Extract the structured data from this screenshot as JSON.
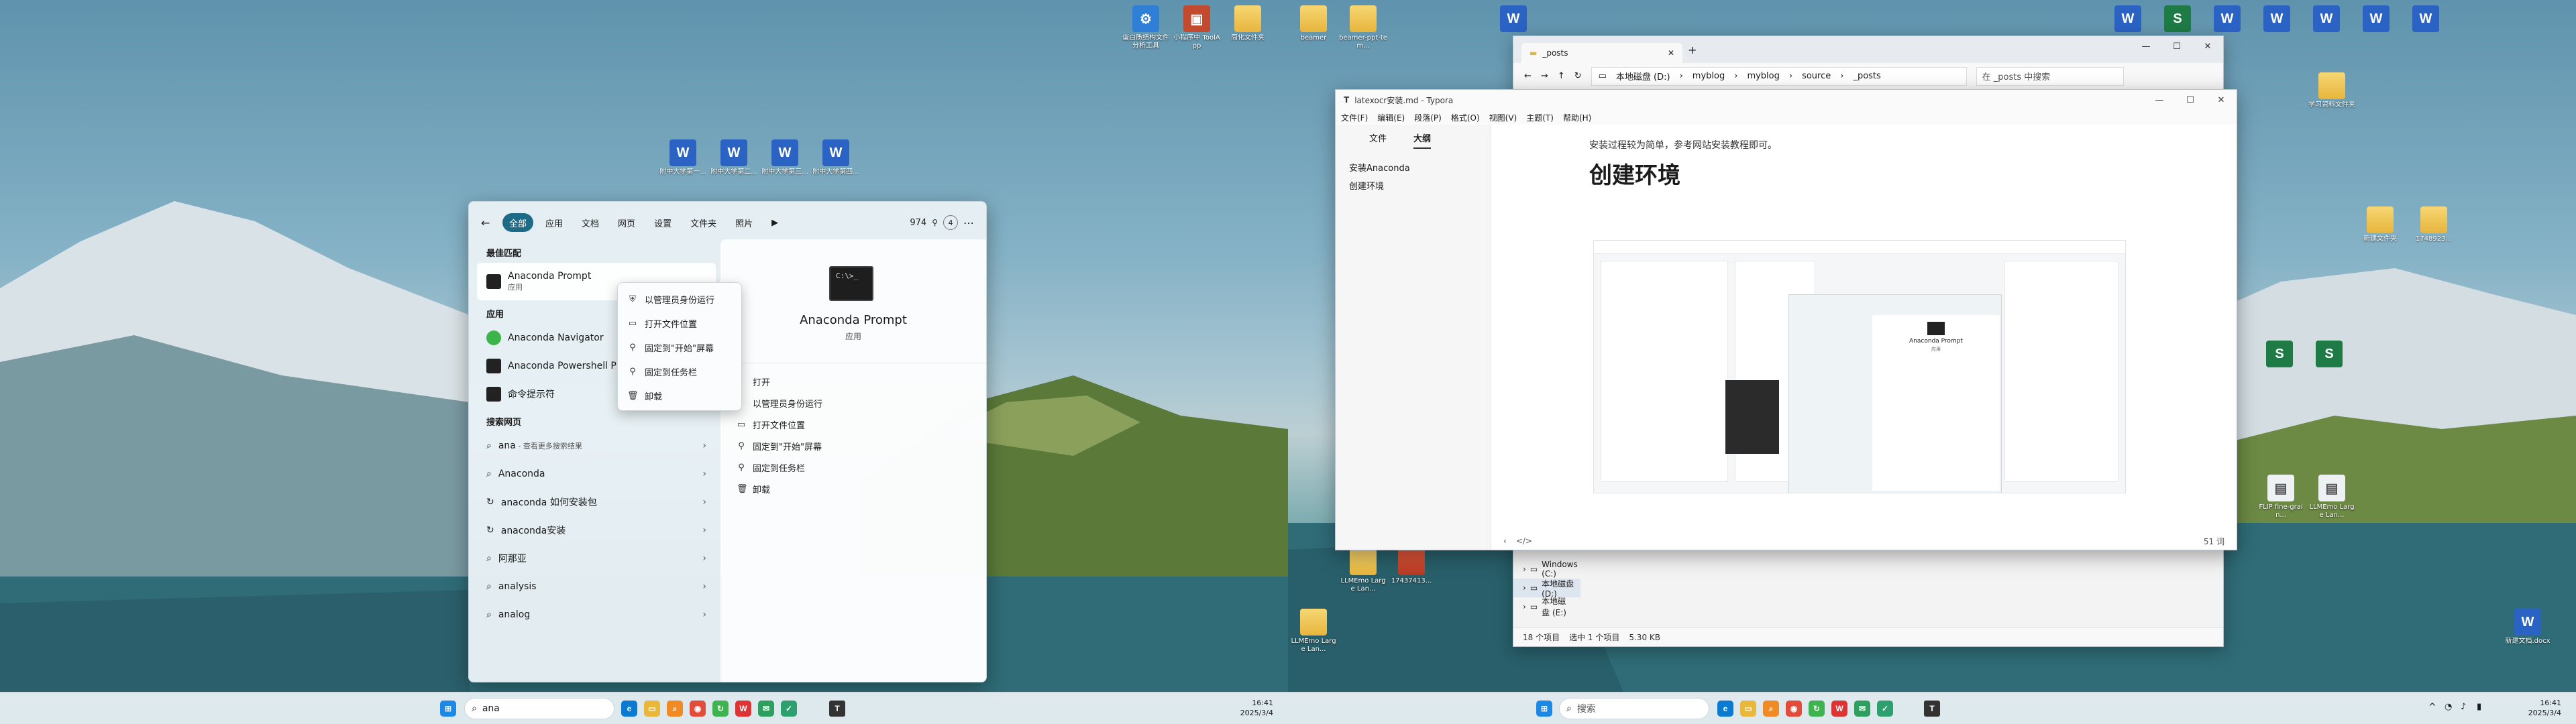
{
  "colors": {
    "accent": "#1d6b86",
    "word": "#2b63c5",
    "excel": "#1e7b45",
    "folder": "#f2c94c"
  },
  "left_desktop_icons": [
    {
      "label": "蛋白质结构文件分析工具",
      "type": "app"
    },
    {
      "label": "小程序中 ToolApp",
      "type": "app"
    },
    {
      "label": "简化文件夹",
      "type": "folder"
    },
    {
      "label": "附中大学第一...",
      "type": "word"
    },
    {
      "label": "附中大学第二...",
      "type": "word"
    },
    {
      "label": "附中大学第三...",
      "type": "word"
    },
    {
      "label": "附中大学第四...",
      "type": "word"
    }
  ],
  "right_desktop_icons": [
    {
      "label": "beamer",
      "type": "folder"
    },
    {
      "label": "beamer-ppt-tem...",
      "type": "folder"
    },
    {
      "label": "",
      "type": "word"
    },
    {
      "label": "",
      "type": "word"
    },
    {
      "label": "",
      "type": "excel"
    },
    {
      "label": "",
      "type": "word"
    },
    {
      "label": "",
      "type": "word"
    },
    {
      "label": "",
      "type": "word"
    },
    {
      "label": "",
      "type": "word"
    },
    {
      "label": "",
      "type": "word"
    },
    {
      "label": "学习资料文件夹",
      "type": "folder"
    },
    {
      "label": "新建文件夹",
      "type": "folder"
    },
    {
      "label": "1748923...",
      "type": "folder"
    },
    {
      "label": "",
      "type": "excel"
    },
    {
      "label": "",
      "type": "excel"
    },
    {
      "label": "FLIP fine-grain...",
      "type": "word"
    },
    {
      "label": "LLMEmo Large Lan...",
      "type": "word"
    },
    {
      "label": "LLMEmo Large Lan...",
      "type": "folder"
    },
    {
      "label": "17437413...",
      "type": "folder"
    },
    {
      "label": "LLMEmo Large Lan...",
      "type": "folder"
    },
    {
      "label": "新建文档.docx",
      "type": "word"
    }
  ],
  "start_menu": {
    "tabs": [
      "全部",
      "应用",
      "文档",
      "网页",
      "设置",
      "文件夹",
      "照片"
    ],
    "count": "974",
    "badge": "4",
    "best_match_header": "最佳匹配",
    "best_match": {
      "title": "Anaconda Prompt",
      "subtitle": "应用"
    },
    "apps_header": "应用",
    "apps": [
      "Anaconda Navigator",
      "Anaconda Powershell P",
      "命令提示符"
    ],
    "web_header": "搜索网页",
    "web": [
      {
        "label": "ana",
        "suffix": " - 查看更多搜索结果"
      },
      {
        "label": "Anaconda",
        "suffix": ""
      },
      {
        "label": "anaconda 如何安装包",
        "suffix": ""
      },
      {
        "label": "anaconda安装",
        "suffix": ""
      },
      {
        "label": "阿那亚",
        "suffix": ""
      },
      {
        "label": "analysis",
        "suffix": ""
      },
      {
        "label": "analog",
        "suffix": ""
      }
    ],
    "detail": {
      "title": "Anaconda Prompt",
      "subtitle": "应用",
      "actions": [
        "打开",
        "以管理员身份运行",
        "打开文件位置",
        "固定到\"开始\"屏幕",
        "固定到任务栏",
        "卸载"
      ]
    }
  },
  "context_menu": [
    "以管理员身份运行",
    "打开文件位置",
    "固定到\"开始\"屏幕",
    "固定到任务栏",
    "卸载"
  ],
  "taskbar_left": {
    "search_value": "ana",
    "time": "16:41",
    "date": "2025/3/4"
  },
  "taskbar_right": {
    "search_placeholder": "搜索",
    "time": "16:41",
    "date": "2025/3/4"
  },
  "explorer": {
    "tab_title": "_posts",
    "breadcrumbs": [
      "本地磁盘 (D:)",
      "myblog",
      "myblog",
      "source",
      "_posts"
    ],
    "search_placeholder": "在 _posts 中搜索",
    "drives": [
      "Windows (C:)",
      "本地磁盘 (D:)",
      "本地磁盘 (E:)"
    ],
    "status": {
      "items": "18 个项目",
      "selected": "选中 1 个项目",
      "size": "5.30 KB"
    }
  },
  "typora": {
    "window_title": "latexocr安装.md - Typora",
    "menu": [
      "文件(F)",
      "编辑(E)",
      "段落(P)",
      "格式(O)",
      "视图(V)",
      "主题(T)",
      "帮助(H)"
    ],
    "side_tabs": [
      "文件",
      "大纲"
    ],
    "outline": [
      "安装Anaconda",
      "创建环境"
    ],
    "paragraph": "安装过程较为简单，参考网站安装教程即可。",
    "heading": "创建环境",
    "embedded_menu_title": "Anaconda Prompt",
    "embedded_menu_subtitle": "应用",
    "word_count": "51 词"
  }
}
